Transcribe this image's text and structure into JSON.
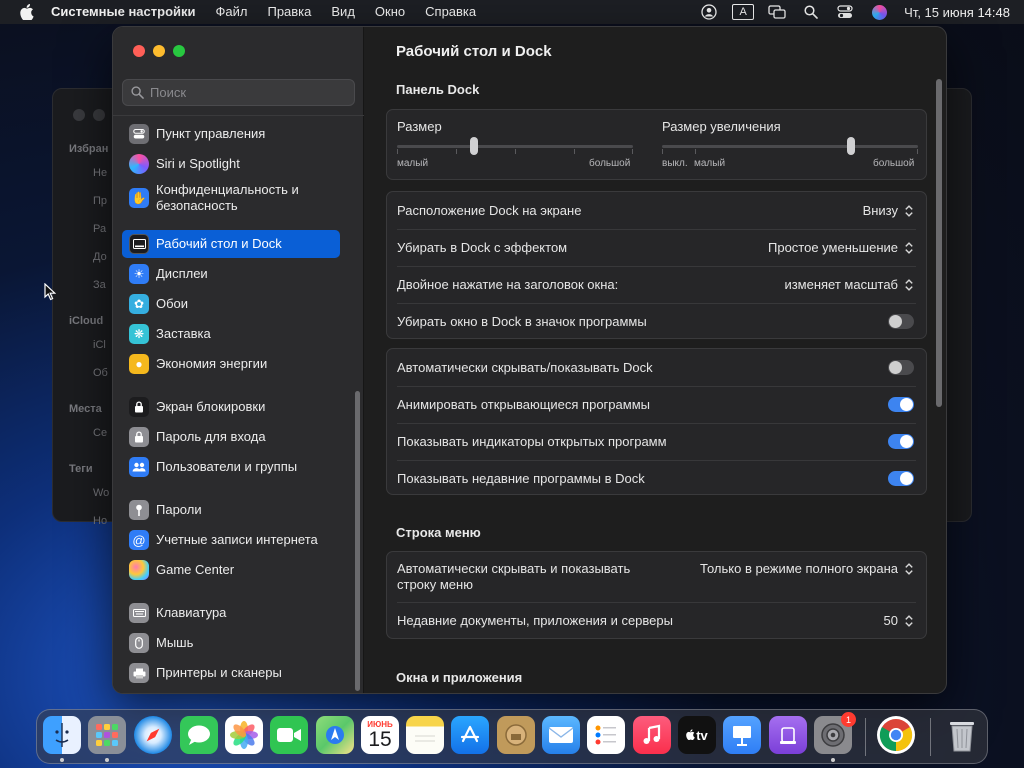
{
  "menubar": {
    "app_name": "Системные настройки",
    "items": [
      "Файл",
      "Правка",
      "Вид",
      "Окно",
      "Справка"
    ],
    "input_source": "A",
    "clock": "Чт, 15 июня  14:48"
  },
  "background_window": {
    "sidebar_labels": [
      "Избран",
      "Не",
      "Пр",
      "Ра",
      "До",
      "За",
      "iCloud",
      "iCl",
      "Об",
      "Места",
      "Се",
      "Теги",
      "Wo",
      "Ho"
    ]
  },
  "sidebar": {
    "search_placeholder": "Поиск",
    "items": [
      {
        "label": "Пункт управления",
        "color": "#6e6e73"
      },
      {
        "label": "Siri и Spotlight",
        "color": "#9b59d6"
      },
      {
        "label": "Конфиденциальность и безопасность",
        "color": "#2f7cf6"
      },
      {
        "label": "Рабочий стол и Dock",
        "color": "#1c1c1e",
        "selected": true
      },
      {
        "label": "Дисплеи",
        "color": "#2f7cf6"
      },
      {
        "label": "Обои",
        "color": "#35aee0"
      },
      {
        "label": "Заставка",
        "color": "#35c3d6"
      },
      {
        "label": "Экономия энергии",
        "color": "#f5b81d"
      },
      {
        "label": "Экран блокировки",
        "color": "#1c1c1e"
      },
      {
        "label": "Пароль для входа",
        "color": "#8e8e93"
      },
      {
        "label": "Пользователи и группы",
        "color": "#2f7cf6"
      },
      {
        "label": "Пароли",
        "color": "#8e8e93"
      },
      {
        "label": "Учетные записи интернета",
        "color": "#2f7cf6"
      },
      {
        "label": "Game Center",
        "color": "#ffffff"
      },
      {
        "label": "Клавиатура",
        "color": "#8e8e93"
      },
      {
        "label": "Мышь",
        "color": "#8e8e93"
      },
      {
        "label": "Принтеры и сканеры",
        "color": "#8e8e93"
      }
    ]
  },
  "content": {
    "title": "Рабочий стол и Dock",
    "dock_section": {
      "heading": "Панель Dock",
      "size": {
        "label": "Размер",
        "min": "малый",
        "max": "большой",
        "value_fraction": 0.33
      },
      "magnification": {
        "label": "Размер увеличения",
        "off": "выкл.",
        "min": "малый",
        "max": "большой",
        "value_fraction": 0.73
      },
      "rows": [
        {
          "label": "Расположение Dock на экране",
          "value": "Внизу"
        },
        {
          "label": "Убирать в Dock с эффектом",
          "value": "Простое уменьшение"
        },
        {
          "label": "Двойное нажатие на заголовок окна:",
          "value": "изменяет масштаб"
        },
        {
          "label": "Убирать окно в Dock в значок программы",
          "toggle": false
        }
      ],
      "toggles": [
        {
          "label": "Автоматически скрывать/показывать Dock",
          "on": false
        },
        {
          "label": "Анимировать открывающиеся программы",
          "on": true
        },
        {
          "label": "Показывать индикаторы открытых программ",
          "on": true
        },
        {
          "label": "Показывать недавние программы в Dock",
          "on": true
        }
      ]
    },
    "menubar_section": {
      "heading": "Строка меню",
      "rows": [
        {
          "label": "Автоматически скрывать и показывать строку меню",
          "value": "Только в режиме полного экрана"
        },
        {
          "label": "Недавние документы, приложения и серверы",
          "value": "50"
        }
      ]
    },
    "windows_section": {
      "heading": "Окна и приложения"
    }
  },
  "dock": {
    "apps": [
      {
        "name": "Finder",
        "icon": "finder-icon",
        "color": "#2f8cf0",
        "running": true
      },
      {
        "name": "Launchpad",
        "icon": "launchpad-icon",
        "color": "#8a8f98",
        "running": true
      },
      {
        "name": "Safari",
        "icon": "safari-icon",
        "color": "#1e88e5"
      },
      {
        "name": "Сообщения",
        "icon": "messages-icon",
        "color": "#34c759"
      },
      {
        "name": "Фото",
        "icon": "photos-icon",
        "color": "#ffffff"
      },
      {
        "name": "FaceTime",
        "icon": "facetime-icon",
        "color": "#30c552"
      },
      {
        "name": "Карты",
        "icon": "maps-icon",
        "color": "#5ac86a"
      },
      {
        "name": "Календарь",
        "icon": "calendar-icon",
        "color": "#ffffff",
        "month": "ИЮНЬ",
        "day": "15"
      },
      {
        "name": "Заметки",
        "icon": "notes-icon",
        "color": "#f7d44a"
      },
      {
        "name": "App Store",
        "icon": "appstore-icon",
        "color": "#1f8ef1"
      },
      {
        "name": "Утилита",
        "icon": "archive-icon",
        "color": "#c09a5b"
      },
      {
        "name": "Почта",
        "icon": "mail-icon",
        "color": "#3d9cf5"
      },
      {
        "name": "Напоминания",
        "icon": "reminders-icon",
        "color": "#ffffff"
      },
      {
        "name": "Музыка",
        "icon": "music-icon",
        "color": "#fb4a60"
      },
      {
        "name": "TV",
        "icon": "tv-icon",
        "color": "#111111",
        "text": "tv"
      },
      {
        "name": "Keynote",
        "icon": "keynote-icon",
        "color": "#2f7ef5"
      },
      {
        "name": "Podcasts",
        "icon": "podcast-icon",
        "color": "#8e52d9"
      },
      {
        "name": "Системные настройки",
        "icon": "settings-icon",
        "color": "#8a8a8e",
        "badge": "1",
        "running": true
      },
      {
        "name": "Chrome",
        "icon": "chrome-icon",
        "color": "#ffffff"
      },
      {
        "name": "Корзина",
        "icon": "trash-icon",
        "color": "#cfd1d6"
      }
    ]
  }
}
